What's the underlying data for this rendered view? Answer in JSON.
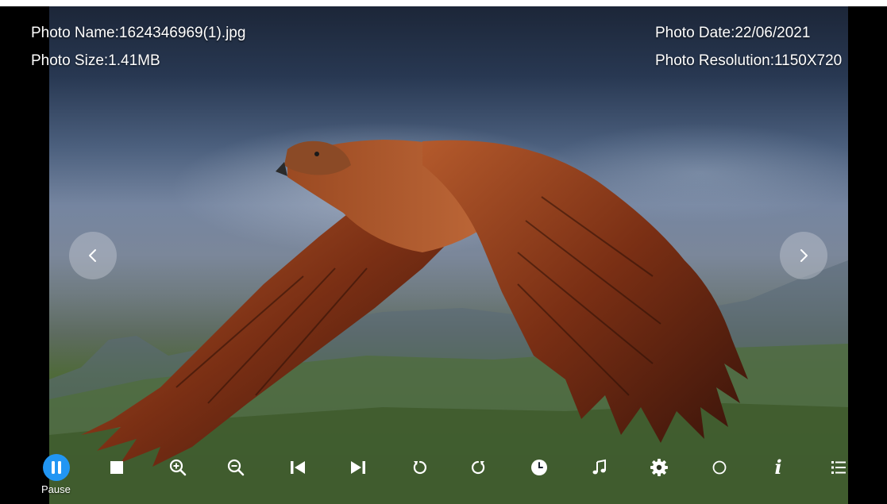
{
  "photo_info": {
    "name_label": "Photo Name:",
    "name_value": "1624346969(1).jpg",
    "size_label": "Photo Size:",
    "size_value": "1.41MB",
    "date_label": "Photo Date:",
    "date_value": "22/06/2021",
    "resolution_label": "Photo Resolution:",
    "resolution_value": "1150X720"
  },
  "navigation": {
    "prev_icon": "chevron-left-icon",
    "next_icon": "chevron-right-icon"
  },
  "controls": [
    {
      "id": "pause",
      "icon": "pause-icon",
      "label": "Pause",
      "active": true
    },
    {
      "id": "stop",
      "icon": "stop-icon"
    },
    {
      "id": "zoom-in",
      "icon": "zoom-in-icon"
    },
    {
      "id": "zoom-out",
      "icon": "zoom-out-icon"
    },
    {
      "id": "previous",
      "icon": "skip-previous-icon"
    },
    {
      "id": "next",
      "icon": "skip-next-icon"
    },
    {
      "id": "rotate-left",
      "icon": "rotate-left-icon"
    },
    {
      "id": "rotate-right",
      "icon": "rotate-right-icon"
    },
    {
      "id": "duration",
      "icon": "clock-icon"
    },
    {
      "id": "music",
      "icon": "music-note-icon"
    },
    {
      "id": "settings",
      "icon": "gear-icon"
    },
    {
      "id": "effect",
      "icon": "circle-icon"
    },
    {
      "id": "info",
      "icon": "info-icon",
      "glyph": "i"
    },
    {
      "id": "playlist",
      "icon": "list-icon"
    }
  ],
  "colors": {
    "accent": "#2196f3",
    "icon": "#ffffff"
  }
}
